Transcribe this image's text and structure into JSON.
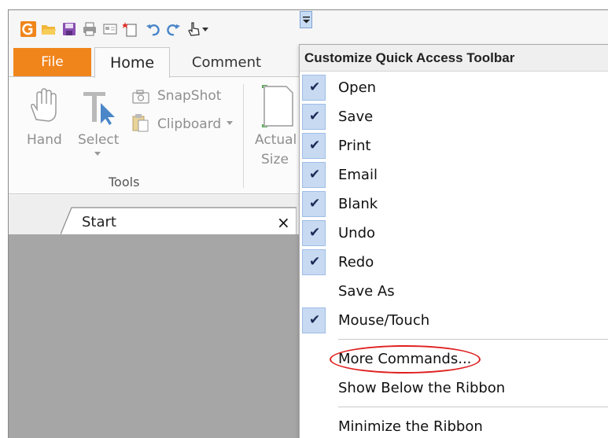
{
  "qat": {
    "icons": [
      "app-logo-icon",
      "open-folder-icon",
      "save-icon",
      "print-icon",
      "email-icon",
      "blank-page-icon",
      "undo-icon",
      "redo-icon",
      "hand-touch-icon",
      "dropdown-arrow-icon"
    ],
    "accent": "#f0851c"
  },
  "tabs": {
    "file": "File",
    "home": "Home",
    "comment": "Comment"
  },
  "ribbon": {
    "hand": "Hand",
    "select": "Select",
    "snapshot": "SnapShot",
    "clipboard": "Clipboard",
    "actual": "Actual",
    "size": "Size",
    "group_tools": "Tools"
  },
  "document": {
    "tab_title": "Start",
    "close": "×"
  },
  "menu": {
    "title": "Customize Quick Access Toolbar",
    "items": [
      {
        "label": "Open",
        "checked": true
      },
      {
        "label": "Save",
        "checked": true
      },
      {
        "label": "Print",
        "checked": true
      },
      {
        "label": "Email",
        "checked": true
      },
      {
        "label": "Blank",
        "checked": true
      },
      {
        "label": "Undo",
        "checked": true
      },
      {
        "label": "Redo",
        "checked": true
      },
      {
        "label": "Save As",
        "checked": false
      },
      {
        "label": "Mouse/Touch",
        "checked": true
      }
    ],
    "more_commands": "More Commands...",
    "show_below": "Show Below the Ribbon",
    "minimize": "Minimize the Ribbon",
    "check_glyph": "✔"
  }
}
